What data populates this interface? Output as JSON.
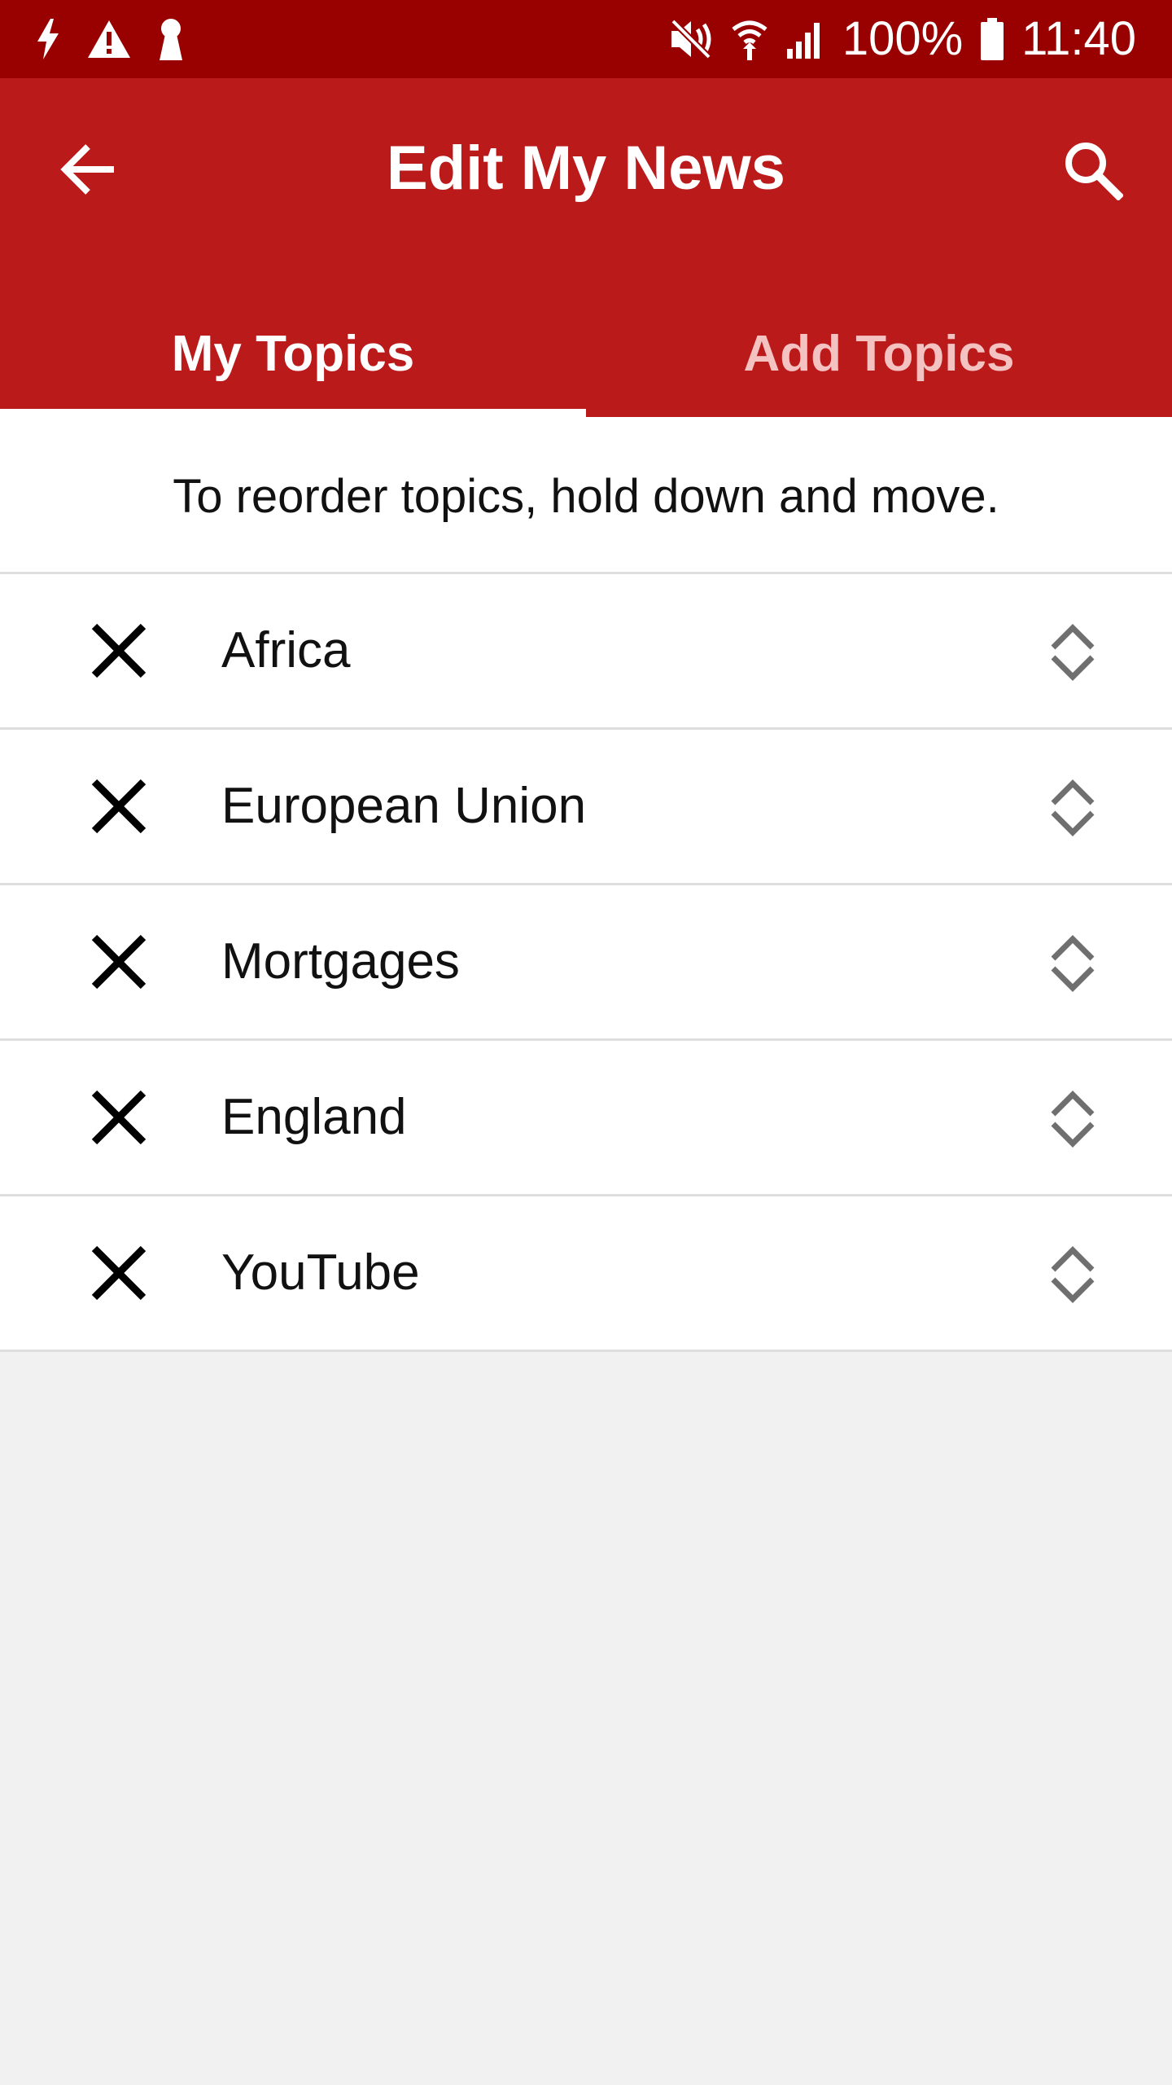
{
  "status_bar": {
    "battery_percent": "100%",
    "time": "11:40",
    "left_icons": [
      "flash-icon",
      "warning-icon",
      "keyhole-icon"
    ],
    "right_icons": [
      "mute-icon",
      "wifi-icon",
      "signal-icon",
      "battery-icon"
    ]
  },
  "app_bar": {
    "title": "Edit My News",
    "back_icon": "arrow-left-icon",
    "search_icon": "search-icon",
    "tabs": [
      {
        "label": "My Topics",
        "selected": true
      },
      {
        "label": "Add Topics",
        "selected": false
      }
    ]
  },
  "hint_text": "To reorder topics, hold down and move.",
  "topics": [
    {
      "label": "Africa"
    },
    {
      "label": "European Union"
    },
    {
      "label": "Mortgages"
    },
    {
      "label": "England"
    },
    {
      "label": "YouTube"
    }
  ],
  "colors": {
    "status_bar": "#990000",
    "app_bar": "#bb1a1a",
    "background": "#f1f1f1"
  }
}
